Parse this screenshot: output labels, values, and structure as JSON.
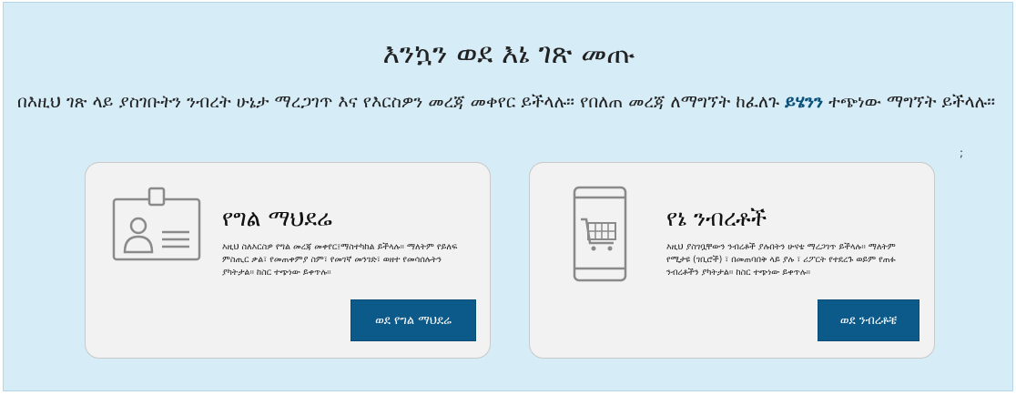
{
  "page": {
    "title": "እንኳን ወደ እኔ ገጽ መጡ",
    "intro_text": "በእዚህ ገጽ ላይ ያስገቡትን ንብረት ሁኔታ ማረጋገጥ እና የእርስዎን መረጃ መቀየር ይችላሉ። የበለጠ መረጃ ለማግኘት ከፈለጉ ",
    "intro_link": "ይሄንን",
    "intro_tail": " ተጭነው ማግኘት ይችላሉ።",
    "stray_mark": ";"
  },
  "cards": [
    {
      "icon": "id-badge-icon",
      "title": "የግል ማህደሬ",
      "description": "እዚህ ስለእርስዎ የግል መረጃ መቀየር፤ማስተካከል ይችላሉ። ማለትም የይለፍ ምስጢር ቃል፣ የመጠቀምያ ስም፣ የመገኛ መንገድ፣ ወዘተ የመሳሰሉትን ያካትታል። ከስር ተጭነው ይቀጥሉ።",
      "button_label": "ወደ የግል ማህደሬ"
    },
    {
      "icon": "mobile-cart-icon",
      "title": "የኔ ንብረቶች",
      "description": "እዚህ ያስገቧቸውን ንብረቶች ያሉበትን ሁናቴ ማረጋገጥ ይችላሉ። ማለትም የሚታዩ (ገቢሮች) ፣ በመጠባበቅ ላይ ያሉ ፣ ሪፖርት የተደረጉ ወይም የጠፉ ንብረቶችን ያካትታል። ከስር ተጭነው ይቀጥሉ።",
      "button_label": "ወደ ንብረቶቼ"
    }
  ],
  "colors": {
    "panel_bg": "#d6ecf7",
    "button_bg": "#0b5a8a",
    "link": "#0a4f7a"
  }
}
